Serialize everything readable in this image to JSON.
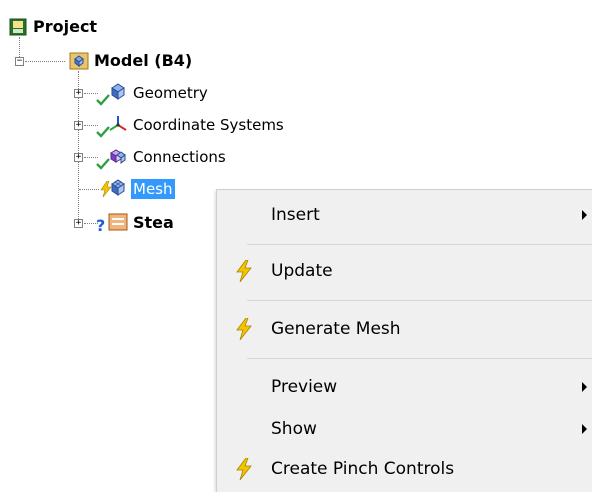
{
  "tree": {
    "root_label": "Project",
    "model_label": "Model (B4)",
    "geometry_label": "Geometry",
    "coord_label": "Coordinate Systems",
    "connections_label": "Connections",
    "mesh_label": "Mesh",
    "steady_label": "Stea",
    "steady_status_icon": "?"
  },
  "context_menu": {
    "insert": "Insert",
    "update": "Update",
    "generate_mesh": "Generate Mesh",
    "preview": "Preview",
    "show": "Show",
    "create_pinch": "Create Pinch Controls"
  },
  "colors": {
    "selection": "#3399ff",
    "bolt": "#f5c400",
    "check": "#2ea043",
    "status_question": "#1f5fd6"
  }
}
